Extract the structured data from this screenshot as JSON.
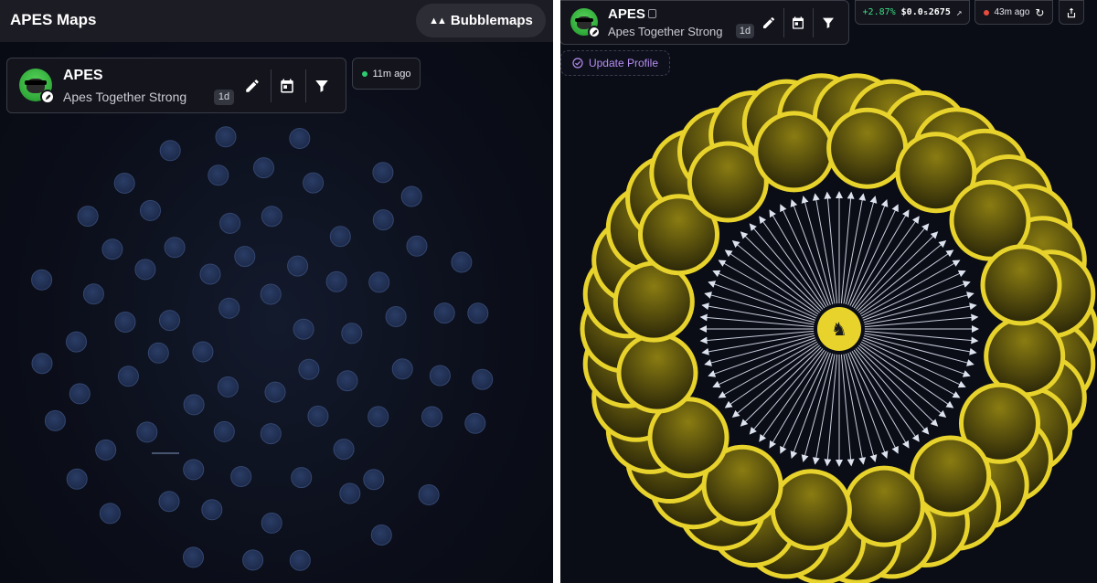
{
  "left": {
    "app_title": "APES Maps",
    "bubblemaps_button": "Bubblemaps",
    "token": {
      "name": "APES",
      "subtitle": "Apes Together Strong",
      "age": "1d"
    },
    "status": {
      "text": "11m ago",
      "dot_color": "#2ecc71"
    },
    "bubble_color": "#1c2a4a"
  },
  "right": {
    "token": {
      "name": "APES",
      "subtitle": "Apes Together Strong",
      "age": "1d"
    },
    "price": {
      "change": "+2.87%",
      "value": "$0.0₅2675",
      "change_color": "#3ddc84"
    },
    "status": {
      "text": "43m ago",
      "dot_color": "#e74c3c"
    },
    "update_profile": "Update Profile",
    "bubble_color": "#e8d32c",
    "accent_color": "#b58df0"
  },
  "icons": [
    "bubblemaps-icon",
    "rocket-icon",
    "pencil-icon",
    "calendar-icon",
    "filter-icon",
    "copy-icon",
    "chart-line-icon",
    "refresh-icon",
    "share-icon",
    "check-circle-icon",
    "unicorn-icon"
  ]
}
